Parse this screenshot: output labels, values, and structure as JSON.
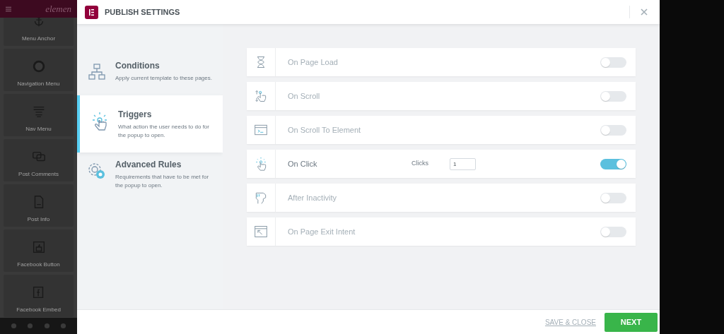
{
  "editor_sidebar": {
    "logo_text": "elemen",
    "widgets": [
      "Menu Anchor",
      "Navigation Menu",
      "Nav Menu",
      "Post Comments",
      "Post Info",
      "Facebook Button",
      "Facebook Embed"
    ]
  },
  "modal": {
    "title": "PUBLISH SETTINGS",
    "sections": [
      {
        "title": "Conditions",
        "description": "Apply current template to these pages.",
        "selected": false
      },
      {
        "title": "Triggers",
        "description": "What action the user needs to do for the popup to open.",
        "selected": true
      },
      {
        "title": "Advanced Rules",
        "description": "Requirements that have to be met for the popup to open.",
        "selected": false
      }
    ],
    "triggers": [
      {
        "label": "On Page Load",
        "on": false
      },
      {
        "label": "On Scroll",
        "on": false
      },
      {
        "label": "On Scroll To Element",
        "on": false
      },
      {
        "label": "On Click",
        "on": true,
        "field": {
          "label": "Clicks",
          "value": "1"
        }
      },
      {
        "label": "After Inactivity",
        "on": false
      },
      {
        "label": "On Page Exit Intent",
        "on": false
      }
    ],
    "footer": {
      "save_close": "SAVE & CLOSE",
      "next": "NEXT"
    }
  }
}
